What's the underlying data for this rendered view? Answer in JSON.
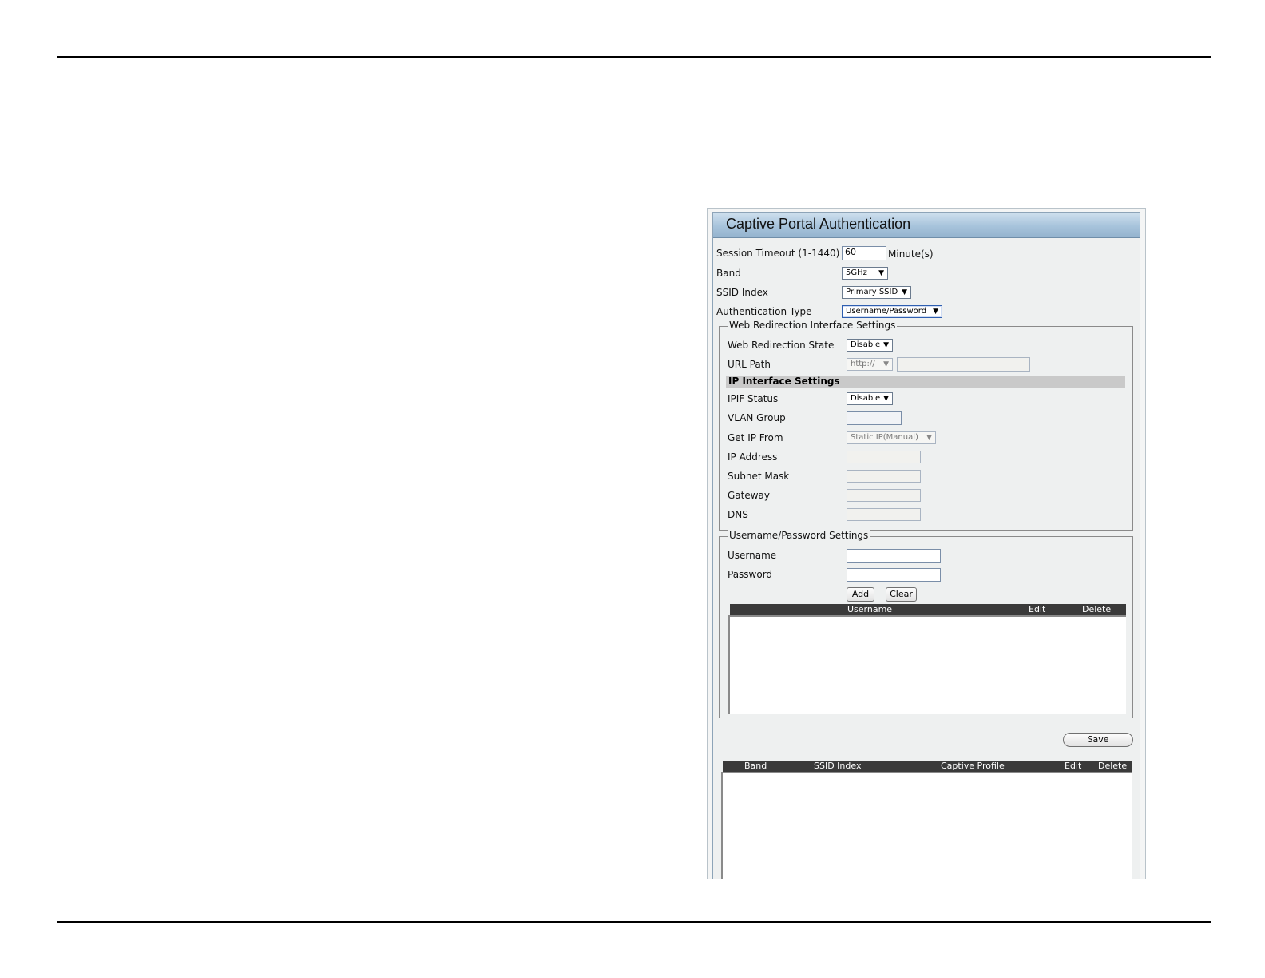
{
  "panel": {
    "title": "Captive Portal Authentication"
  },
  "session_timeout": {
    "label": "Session Timeout (1-1440)",
    "value": "60",
    "unit": "Minute(s)"
  },
  "band": {
    "label": "Band",
    "selected": "5GHz"
  },
  "ssid_index": {
    "label": "SSID Index",
    "selected": "Primary SSID"
  },
  "auth_type": {
    "label": "Authentication Type",
    "selected": "Username/Password"
  },
  "web_redirection": {
    "legend": "Web Redirection Interface Settings",
    "state_label": "Web Redirection State",
    "state_selected": "Disable",
    "url_label": "URL Path",
    "url_scheme": "http://",
    "url_value": ""
  },
  "ip_interface": {
    "heading": "IP Interface Settings",
    "ipif_label": "IPIF Status",
    "ipif_selected": "Disable",
    "vlan_label": "VLAN Group",
    "vlan_value": "",
    "getip_label": "Get IP From",
    "getip_selected": "Static IP(Manual)",
    "ip_label": "IP Address",
    "subnet_label": "Subnet Mask",
    "gateway_label": "Gateway",
    "dns_label": "DNS"
  },
  "userpass": {
    "legend": "Username/Password Settings",
    "username_label": "Username",
    "username_value": "",
    "password_label": "Password",
    "password_value": "",
    "add_label": "Add",
    "clear_label": "Clear",
    "table_headers": [
      "Username",
      "Edit",
      "Delete"
    ]
  },
  "save_label": "Save",
  "profile_table": {
    "headers": [
      "Band",
      "SSID Index",
      "Captive Profile",
      "Edit",
      "Delete"
    ]
  }
}
